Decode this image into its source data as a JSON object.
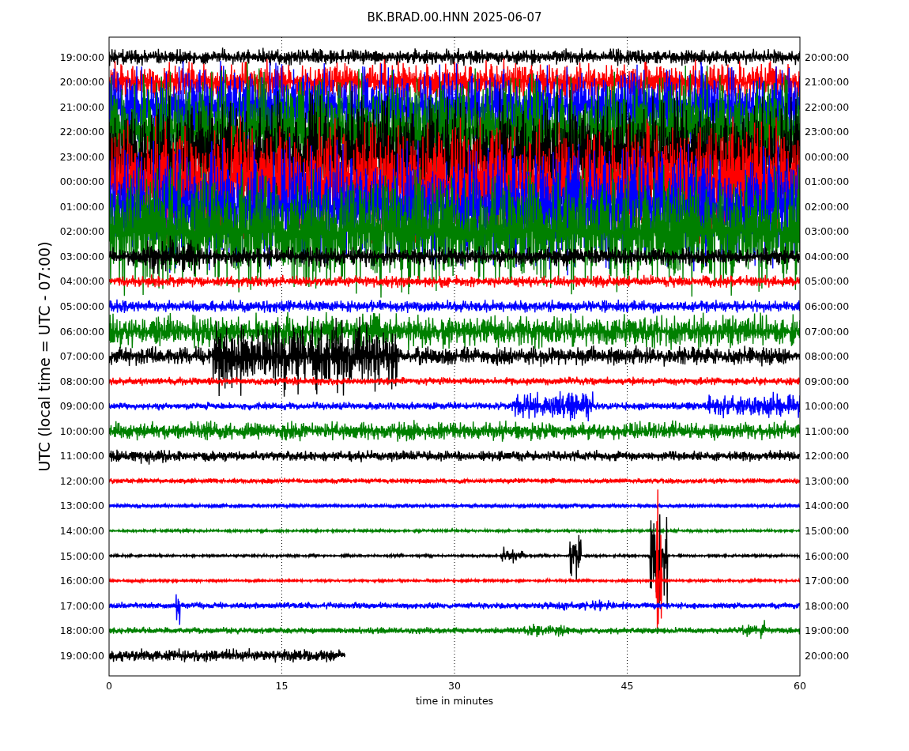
{
  "title": "BK.BRAD.00.HNN 2025-06-07",
  "ylabel": "UTC (local time = UTC - 07:00)",
  "xlabel": "time in minutes",
  "xticks": [
    "0",
    "15",
    "30",
    "45",
    "60"
  ],
  "rows": [
    {
      "left": "19:00:00",
      "right": "20:00:00",
      "color": "#000000"
    },
    {
      "left": "20:00:00",
      "right": "21:00:00",
      "color": "#ff0000"
    },
    {
      "left": "21:00:00",
      "right": "22:00:00",
      "color": "#0000ff"
    },
    {
      "left": "22:00:00",
      "right": "23:00:00",
      "color": "#008000"
    },
    {
      "left": "23:00:00",
      "right": "00:00:00",
      "color": "#000000"
    },
    {
      "left": "00:00:00",
      "right": "01:00:00",
      "color": "#ff0000"
    },
    {
      "left": "01:00:00",
      "right": "02:00:00",
      "color": "#0000ff"
    },
    {
      "left": "02:00:00",
      "right": "03:00:00",
      "color": "#008000"
    },
    {
      "left": "03:00:00",
      "right": "04:00:00",
      "color": "#000000"
    },
    {
      "left": "04:00:00",
      "right": "05:00:00",
      "color": "#ff0000"
    },
    {
      "left": "05:00:00",
      "right": "06:00:00",
      "color": "#0000ff"
    },
    {
      "left": "06:00:00",
      "right": "07:00:00",
      "color": "#008000"
    },
    {
      "left": "07:00:00",
      "right": "08:00:00",
      "color": "#000000"
    },
    {
      "left": "08:00:00",
      "right": "09:00:00",
      "color": "#ff0000"
    },
    {
      "left": "09:00:00",
      "right": "10:00:00",
      "color": "#0000ff"
    },
    {
      "left": "10:00:00",
      "right": "11:00:00",
      "color": "#008000"
    },
    {
      "left": "11:00:00",
      "right": "12:00:00",
      "color": "#000000"
    },
    {
      "left": "12:00:00",
      "right": "13:00:00",
      "color": "#ff0000"
    },
    {
      "left": "13:00:00",
      "right": "14:00:00",
      "color": "#0000ff"
    },
    {
      "left": "14:00:00",
      "right": "15:00:00",
      "color": "#008000"
    },
    {
      "left": "15:00:00",
      "right": "16:00:00",
      "color": "#000000"
    },
    {
      "left": "16:00:00",
      "right": "17:00:00",
      "color": "#ff0000"
    },
    {
      "left": "17:00:00",
      "right": "18:00:00",
      "color": "#0000ff"
    },
    {
      "left": "18:00:00",
      "right": "19:00:00",
      "color": "#008000"
    },
    {
      "left": "19:00:00",
      "right": "20:00:00",
      "color": "#000000"
    }
  ]
}
